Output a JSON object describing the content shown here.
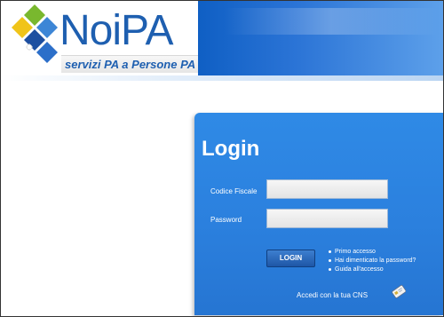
{
  "header": {
    "logo_title": "NoiPA",
    "tagline": "servizi PA a Persone PA"
  },
  "login": {
    "title": "Login",
    "codice_fiscale_label": "Codice Fiscale",
    "codice_fiscale_value": "",
    "password_label": "Password",
    "password_value": "",
    "button_label": "LOGIN",
    "links": [
      {
        "label": "Primo accesso"
      },
      {
        "label": "Hai dimenticato la password?"
      },
      {
        "label": "Guida all'accesso"
      }
    ],
    "cns_label": "Accedi con la tua CNS"
  },
  "colors": {
    "brand_blue": "#1e5fb0",
    "panel_blue": "#2b80de",
    "header_band": "#0f5fc4"
  },
  "icons": {
    "logo_mark": "diamond-cluster",
    "cns": "smart-card-icon"
  }
}
